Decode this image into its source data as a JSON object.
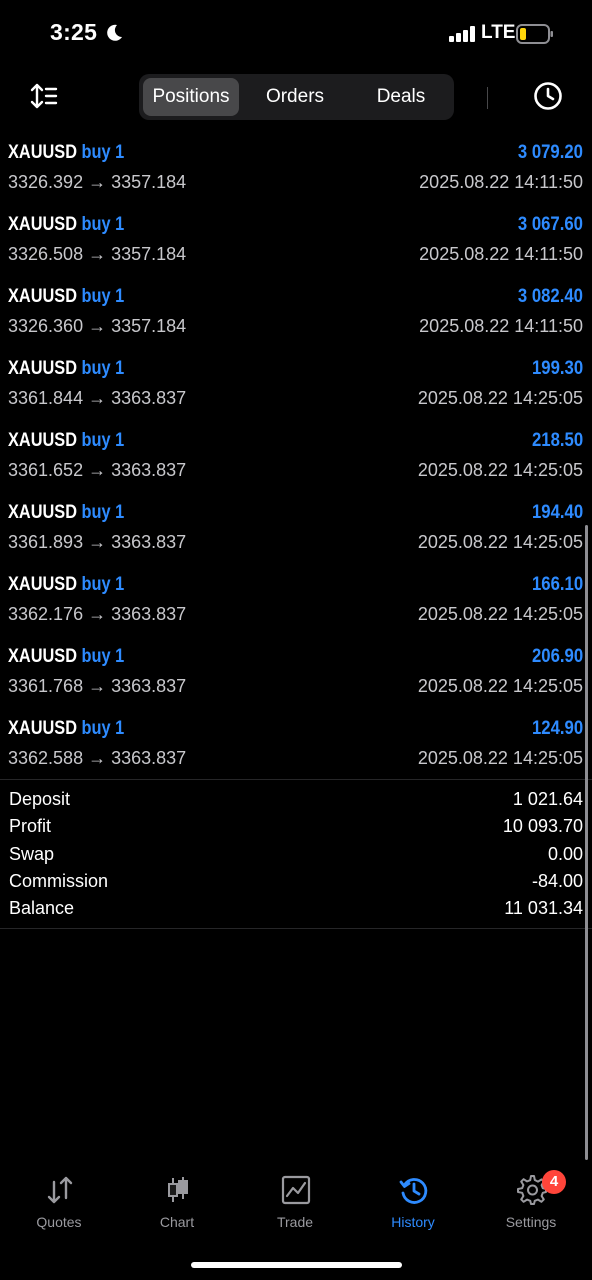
{
  "status_bar": {
    "time": "3:25",
    "network": "LTE",
    "battery_color": "#ffd60a"
  },
  "header": {
    "tabs": [
      {
        "label": "Positions",
        "active": true
      },
      {
        "label": "Orders",
        "active": false
      },
      {
        "label": "Deals",
        "active": false
      }
    ],
    "left_icon": "sort-list-icon",
    "right_icon": "clock-icon"
  },
  "deals": [
    {
      "symbol": "XAUUSD",
      "type": "buy 1",
      "profit": "3 079.20",
      "prices": "3326.392 → 3357.184",
      "time": "2025.08.22 14:11:50"
    },
    {
      "symbol": "XAUUSD",
      "type": "buy 1",
      "profit": "3 067.60",
      "prices": "3326.508 → 3357.184",
      "time": "2025.08.22 14:11:50"
    },
    {
      "symbol": "XAUUSD",
      "type": "buy 1",
      "profit": "3 082.40",
      "prices": "3326.360 → 3357.184",
      "time": "2025.08.22 14:11:50"
    },
    {
      "symbol": "XAUUSD",
      "type": "buy 1",
      "profit": "199.30",
      "prices": "3361.844 → 3363.837",
      "time": "2025.08.22 14:25:05"
    },
    {
      "symbol": "XAUUSD",
      "type": "buy 1",
      "profit": "218.50",
      "prices": "3361.652 → 3363.837",
      "time": "2025.08.22 14:25:05"
    },
    {
      "symbol": "XAUUSD",
      "type": "buy 1",
      "profit": "194.40",
      "prices": "3361.893 → 3363.837",
      "time": "2025.08.22 14:25:05"
    },
    {
      "symbol": "XAUUSD",
      "type": "buy 1",
      "profit": "166.10",
      "prices": "3362.176 → 3363.837",
      "time": "2025.08.22 14:25:05"
    },
    {
      "symbol": "XAUUSD",
      "type": "buy 1",
      "profit": "206.90",
      "prices": "3361.768 → 3363.837",
      "time": "2025.08.22 14:25:05"
    },
    {
      "symbol": "XAUUSD",
      "type": "buy 1",
      "profit": "124.90",
      "prices": "3362.588 → 3363.837",
      "time": "2025.08.22 14:25:05"
    }
  ],
  "summary": [
    {
      "label": "Deposit",
      "value": "1 021.64"
    },
    {
      "label": "Profit",
      "value": "10 093.70"
    },
    {
      "label": "Swap",
      "value": "0.00"
    },
    {
      "label": "Commission",
      "value": "-84.00"
    },
    {
      "label": "Balance",
      "value": "11 031.34"
    }
  ],
  "tabbar": [
    {
      "label": "Quotes",
      "icon": "quotes-arrows-icon",
      "active": false
    },
    {
      "label": "Chart",
      "icon": "candlestick-icon",
      "active": false
    },
    {
      "label": "Trade",
      "icon": "trade-chart-icon",
      "active": false
    },
    {
      "label": "History",
      "icon": "history-icon",
      "active": true
    },
    {
      "label": "Settings",
      "icon": "gear-icon",
      "active": false,
      "badge": "4"
    }
  ],
  "colors": {
    "accent": "#2e8bff",
    "badge": "#ff453a",
    "background": "#000000"
  }
}
